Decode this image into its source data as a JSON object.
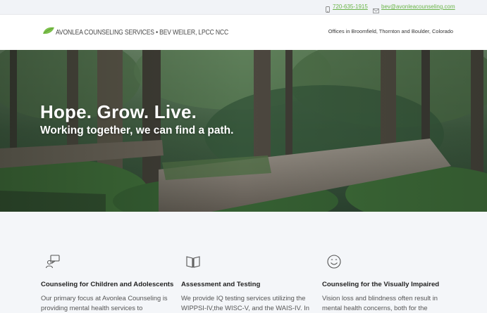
{
  "topbar": {
    "phone": "720-635-1915",
    "email": "bev@avonleacounseling.com",
    "phone_icon": "phone-icon",
    "email_icon": "mail-icon"
  },
  "header": {
    "logo_text": "Avonlea Counseling Services • Bev Weiler, LPCC NCC",
    "logo_icon": "leaf-icon",
    "offices": "Offices in Broomfield, Thornton and Boulder, Colorado"
  },
  "hero": {
    "headline": "Hope. Grow. Live.",
    "subheadline": "Working together, we can find a path."
  },
  "services": [
    {
      "icon": "chat-person-icon",
      "title": "Counseling for Children and Adolescents",
      "body": "Our primary focus at Avonlea Counseling is providing mental health services to"
    },
    {
      "icon": "book-icon",
      "title": "Assessment and Testing",
      "body": "We provide IQ testing services utilizing the WIPPSI-IV,the WISC-V, and the WAIS-IV. In"
    },
    {
      "icon": "smiley-icon",
      "title": "Counseling for the Visually Impaired",
      "body": "Vision loss and blindness often result in mental health concerns, both for the"
    }
  ],
  "colors": {
    "accent_green": "#6bb54a",
    "hero_overlay": "#2f4a35"
  }
}
